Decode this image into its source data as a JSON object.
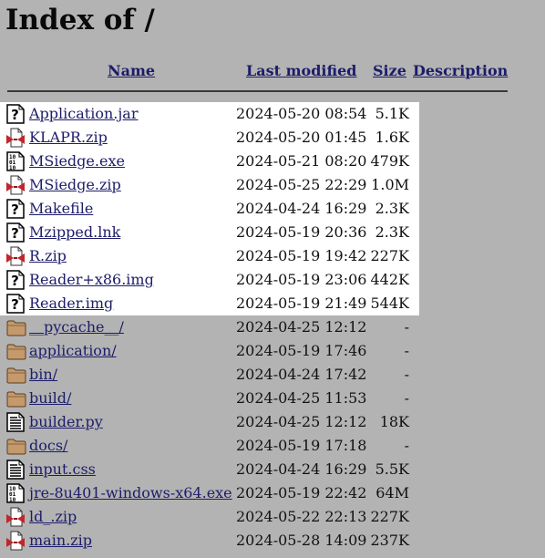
{
  "page": {
    "title": "Index of /"
  },
  "columns": {
    "name": "Name",
    "last_modified": "Last modified",
    "size": "Size",
    "description": "Description"
  },
  "colors": {
    "background": "#b3b3b3",
    "highlight": "#ffffff",
    "link": "#1c1c6a"
  },
  "entries": [
    {
      "name": "Application.jar",
      "modified": "2024-05-20 08:54",
      "size": "5.1K",
      "icon": "unknown-icon"
    },
    {
      "name": "KLAPR.zip",
      "modified": "2024-05-20 01:45",
      "size": "1.6K",
      "icon": "compressed-icon"
    },
    {
      "name": "MSiedge.exe",
      "modified": "2024-05-21 08:20",
      "size": "479K",
      "icon": "binary-icon"
    },
    {
      "name": "MSiedge.zip",
      "modified": "2024-05-25 22:29",
      "size": "1.0M",
      "icon": "compressed-icon"
    },
    {
      "name": "Makefile",
      "modified": "2024-04-24 16:29",
      "size": "2.3K",
      "icon": "unknown-icon"
    },
    {
      "name": "Mzipped.lnk",
      "modified": "2024-05-19 20:36",
      "size": "2.3K",
      "icon": "unknown-icon"
    },
    {
      "name": "R.zip",
      "modified": "2024-05-19 19:42",
      "size": "227K",
      "icon": "compressed-icon"
    },
    {
      "name": "Reader+x86.img",
      "modified": "2024-05-19 23:06",
      "size": "442K",
      "icon": "unknown-icon"
    },
    {
      "name": "Reader.img",
      "modified": "2024-05-19 21:49",
      "size": "544K",
      "icon": "unknown-icon"
    },
    {
      "name": "__pycache__/",
      "modified": "2024-04-25 12:12",
      "size": "-",
      "icon": "folder-icon"
    },
    {
      "name": "application/",
      "modified": "2024-05-19 17:46",
      "size": "-",
      "icon": "folder-icon"
    },
    {
      "name": "bin/",
      "modified": "2024-04-24 17:42",
      "size": "-",
      "icon": "folder-icon"
    },
    {
      "name": "build/",
      "modified": "2024-04-25 11:53",
      "size": "-",
      "icon": "folder-icon"
    },
    {
      "name": "builder.py",
      "modified": "2024-04-25 12:12",
      "size": "18K",
      "icon": "text-file-icon"
    },
    {
      "name": "docs/",
      "modified": "2024-05-19 17:18",
      "size": "-",
      "icon": "folder-icon"
    },
    {
      "name": "input.css",
      "modified": "2024-04-24 16:29",
      "size": "5.5K",
      "icon": "text-file-icon"
    },
    {
      "name": "jre-8u401-windows-x64.exe",
      "modified": "2024-05-19 22:42",
      "size": "64M",
      "icon": "binary-icon"
    },
    {
      "name": "ld_.zip",
      "modified": "2024-05-22 22:13",
      "size": "227K",
      "icon": "compressed-icon"
    },
    {
      "name": "main.zip",
      "modified": "2024-05-28 14:09",
      "size": "237K",
      "icon": "compressed-icon"
    }
  ]
}
